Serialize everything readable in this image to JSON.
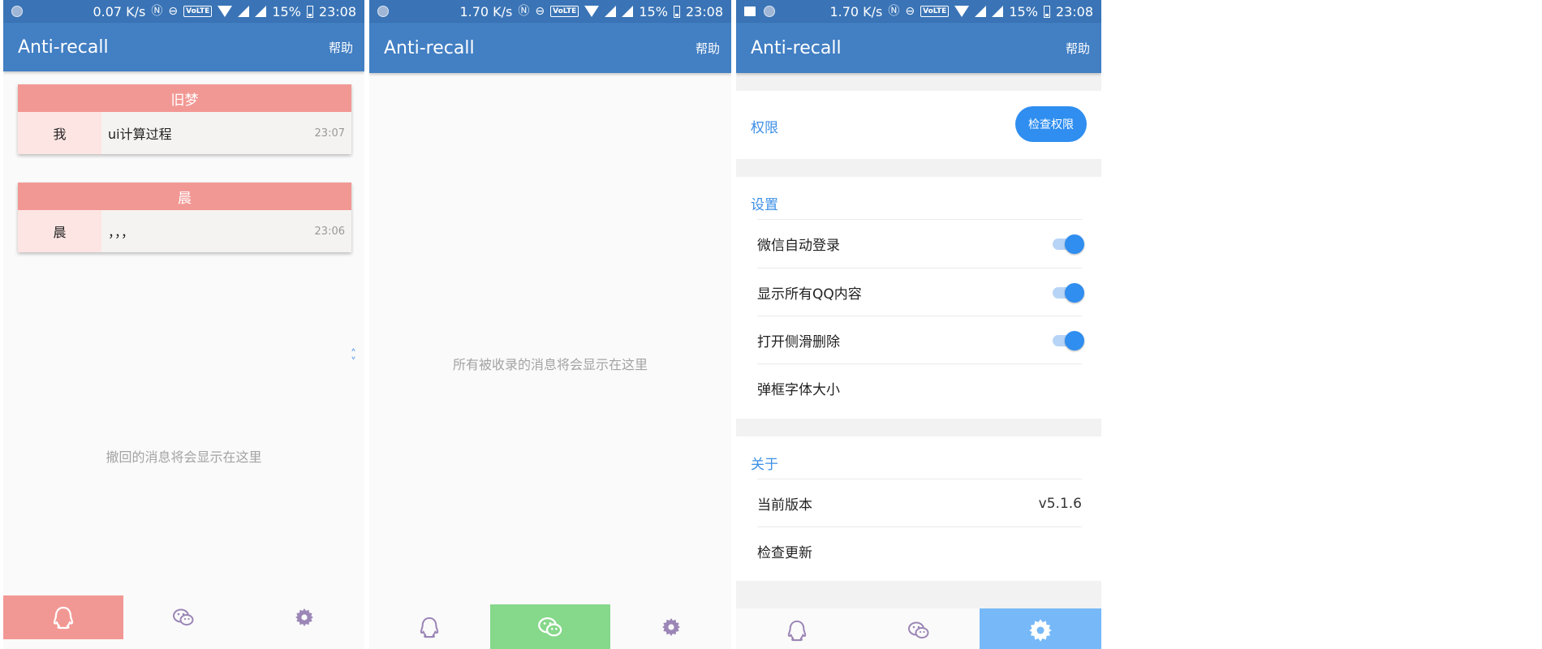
{
  "phones": [
    {
      "status": {
        "speed": "0.07 K/s",
        "battery": "15%",
        "time": "23:08"
      },
      "app_title": "Anti-recall",
      "help_label": "帮助",
      "cards": [
        {
          "group": "旧梦",
          "sender": "我",
          "message": "ui计算过程",
          "time": "23:07"
        },
        {
          "group": "晨",
          "sender": "晨",
          "message": "，，，",
          "time": "23:06"
        }
      ],
      "empty_text": "撤回的消息将会显示在这里",
      "active_tab": "qq"
    },
    {
      "status": {
        "speed": "1.70 K/s",
        "battery": "15%",
        "time": "23:08"
      },
      "app_title": "Anti-recall",
      "help_label": "帮助",
      "empty_text": "所有被收录的消息将会显示在这里",
      "active_tab": "wechat"
    },
    {
      "status": {
        "speed": "1.70 K/s",
        "battery": "15%",
        "time": "23:08"
      },
      "app_title": "Anti-recall",
      "help_label": "帮助",
      "permissions": {
        "title": "权限",
        "button": "检查权限"
      },
      "settings": {
        "title": "设置",
        "rows": [
          {
            "label": "微信自动登录",
            "enabled": true
          },
          {
            "label": "显示所有QQ内容",
            "enabled": true
          },
          {
            "label": "打开侧滑删除",
            "enabled": true
          },
          {
            "label": "弹框字体大小"
          }
        ]
      },
      "about": {
        "title": "关于",
        "version_label": "当前版本",
        "version_value": "v5.1.6",
        "check_update": "检查更新"
      },
      "active_tab": "settings"
    }
  ],
  "colors": {
    "status_bar": "#3a74b6",
    "app_bar": "#427fc3",
    "card_header": "#f29894",
    "tab_qq_active": "#f29894",
    "tab_wechat_active": "#86d88a",
    "tab_settings_active": "#76b8f8",
    "accent": "#2f8ef0",
    "icon_inactive": "#9b86b6"
  },
  "icons": [
    "qq-icon",
    "wechat-icon",
    "gear-icon",
    "nfc-icon",
    "dnd-icon",
    "volte-icon",
    "wifi-icon",
    "signal-icon",
    "battery-icon"
  ]
}
